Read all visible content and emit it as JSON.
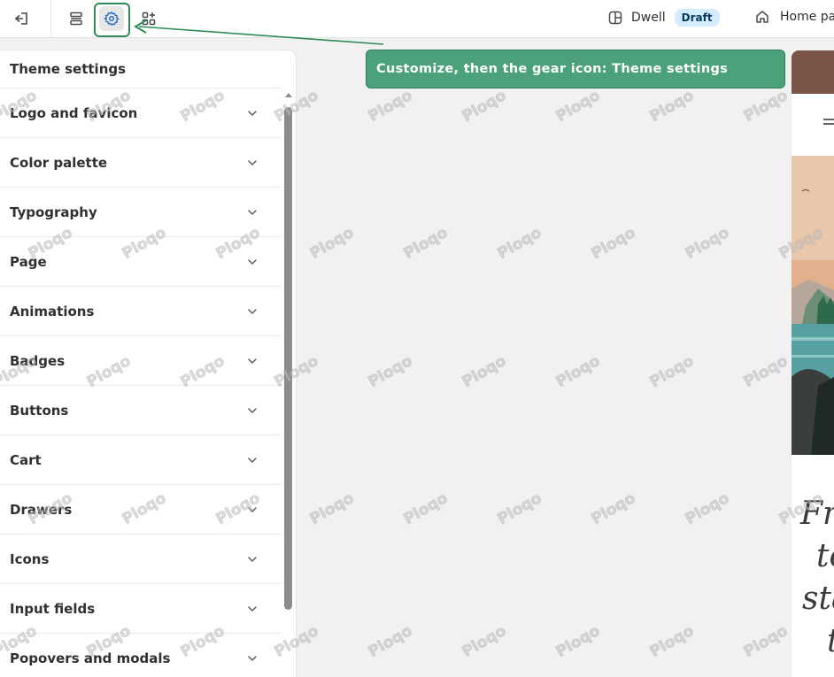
{
  "topbar": {
    "exit_icon": "exit-icon",
    "sections_icon": "sections-icon",
    "gear_icon": "gear-icon",
    "apps_icon": "apps-icon",
    "theme_name": "Dwell",
    "theme_status": "Draft",
    "page_selector": "Home pa"
  },
  "callout": {
    "text": "Customize, then the gear icon: Theme settings",
    "color": "#4ba27a"
  },
  "panel": {
    "title": "Theme settings",
    "items": [
      {
        "label": "Logo and favicon"
      },
      {
        "label": "Color palette"
      },
      {
        "label": "Typography"
      },
      {
        "label": "Page"
      },
      {
        "label": "Animations"
      },
      {
        "label": "Badges"
      },
      {
        "label": "Buttons"
      },
      {
        "label": "Cart"
      },
      {
        "label": "Drawers"
      },
      {
        "label": "Icons"
      },
      {
        "label": "Input fields"
      },
      {
        "label": "Popovers and modals"
      }
    ]
  },
  "preview": {
    "hero_lines": [
      "Fr",
      "to",
      "sta",
      "t"
    ]
  },
  "watermark": "Ploqo"
}
